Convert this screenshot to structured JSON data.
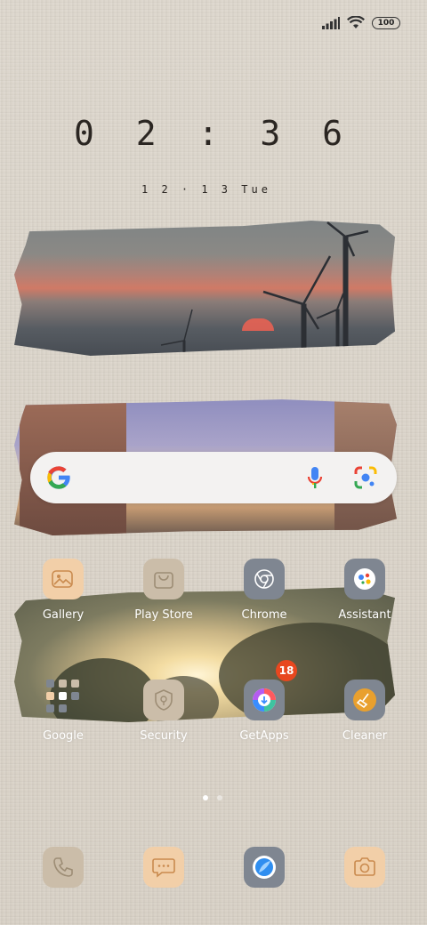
{
  "status_bar": {
    "battery": "100"
  },
  "clock": {
    "time": "0 2 : 3 6",
    "date": "1 2 · 1 3  Tue"
  },
  "search": {
    "label": "Google Search"
  },
  "apps": [
    {
      "label": "Gallery"
    },
    {
      "label": "Play Store"
    },
    {
      "label": "Chrome"
    },
    {
      "label": "Assistant"
    },
    {
      "label": "Google"
    },
    {
      "label": "Security"
    },
    {
      "label": "GetApps",
      "badge": "18"
    },
    {
      "label": "Cleaner"
    }
  ],
  "dock": [
    {
      "name": "Phone"
    },
    {
      "name": "Messages"
    },
    {
      "name": "Browser"
    },
    {
      "name": "Camera"
    }
  ],
  "colors": {
    "tile_peach": "#f2cfa8",
    "tile_tan": "#cbbda9",
    "tile_slate": "#7f8691",
    "badge": "#e8471f"
  }
}
